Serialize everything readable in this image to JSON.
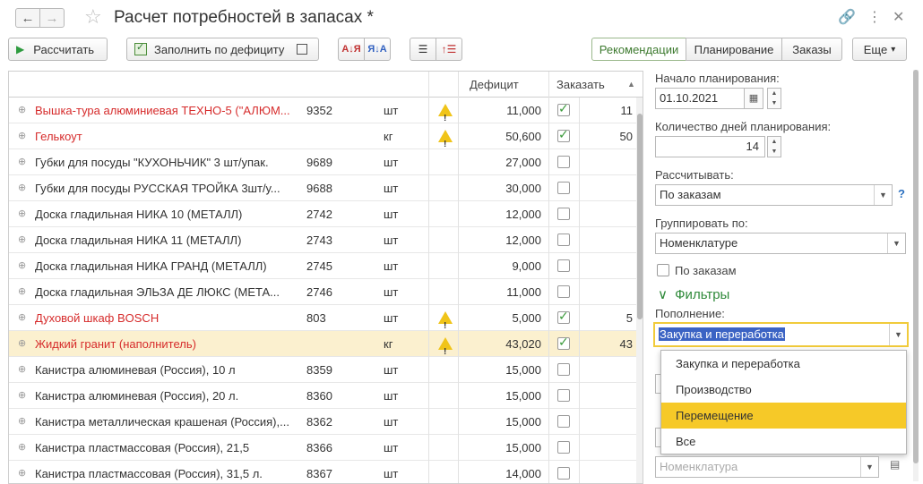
{
  "window": {
    "title": "Расчет потребностей в запасах *",
    "back_icon": "←",
    "forward_icon": "→",
    "star_icon": "☆",
    "link_icon": "🔗",
    "more_icon": "⋮",
    "close_icon": "✕"
  },
  "toolbar": {
    "calculate_label": "Рассчитать",
    "fill_label": "Заполнить по дефициту",
    "sort_asc_label": "А↓Я",
    "sort_desc_label": "Я↓А",
    "tabs": [
      {
        "label": "Рекомендации",
        "active": true
      },
      {
        "label": "Планирование",
        "active": false
      },
      {
        "label": "Заказы",
        "active": false
      }
    ],
    "more_label": "Еще",
    "more_arrow": "▾"
  },
  "table": {
    "columns": {
      "deficit": "Дефицит",
      "order": "Заказать"
    },
    "rows": [
      {
        "name": "Вышка-тура алюминиевая ТЕХНО-5 (\"АЛЮМ...",
        "code": "9352",
        "unit": "шт",
        "warn": true,
        "deficit": "11,000",
        "order": true,
        "cut": "11",
        "red": true,
        "selected": false
      },
      {
        "name": "Гелькоут",
        "code": "",
        "unit": "кг",
        "warn": true,
        "deficit": "50,600",
        "order": true,
        "cut": "50",
        "red": true,
        "selected": false
      },
      {
        "name": "Губки для посуды \"КУХОНЬЧИК\" 3 шт/упак.",
        "code": "9689",
        "unit": "шт",
        "warn": false,
        "deficit": "27,000",
        "order": false,
        "cut": "",
        "red": false,
        "selected": false
      },
      {
        "name": "Губки для посуды РУССКАЯ ТРОЙКА 3шт/у...",
        "code": "9688",
        "unit": "шт",
        "warn": false,
        "deficit": "30,000",
        "order": false,
        "cut": "",
        "red": false,
        "selected": false
      },
      {
        "name": "Доска гладильная  НИКА 10 (МЕТАЛЛ)",
        "code": "2742",
        "unit": "шт",
        "warn": false,
        "deficit": "12,000",
        "order": false,
        "cut": "",
        "red": false,
        "selected": false
      },
      {
        "name": "Доска гладильная  НИКА 11 (МЕТАЛЛ)",
        "code": "2743",
        "unit": "шт",
        "warn": false,
        "deficit": "12,000",
        "order": false,
        "cut": "",
        "red": false,
        "selected": false
      },
      {
        "name": "Доска гладильная  НИКА ГРАНД (МЕТАЛЛ)",
        "code": "2745",
        "unit": "шт",
        "warn": false,
        "deficit": "9,000",
        "order": false,
        "cut": "",
        "red": false,
        "selected": false
      },
      {
        "name": "Доска гладильная  ЭЛЬЗА ДЕ ЛЮКС (МЕТА...",
        "code": "2746",
        "unit": "шт",
        "warn": false,
        "deficit": "11,000",
        "order": false,
        "cut": "",
        "red": false,
        "selected": false
      },
      {
        "name": "Духовой шкаф                  BOSCH",
        "code": "803",
        "unit": "шт",
        "warn": true,
        "deficit": "5,000",
        "order": true,
        "cut": "5",
        "red": true,
        "selected": false
      },
      {
        "name": "Жидкий гранит (наполнитель)",
        "code": "",
        "unit": "кг",
        "warn": true,
        "deficit": "43,020",
        "order": true,
        "cut": "43",
        "red": true,
        "selected": true
      },
      {
        "name": "Канистра алюминевая (Россия), 10 л",
        "code": "8359",
        "unit": "шт",
        "warn": false,
        "deficit": "15,000",
        "order": false,
        "cut": "",
        "red": false,
        "selected": false
      },
      {
        "name": "Канистра алюминевая (Россия), 20 л.",
        "code": "8360",
        "unit": "шт",
        "warn": false,
        "deficit": "15,000",
        "order": false,
        "cut": "",
        "red": false,
        "selected": false
      },
      {
        "name": "Канистра металлическая крашеная (Россия),...",
        "code": "8362",
        "unit": "шт",
        "warn": false,
        "deficit": "15,000",
        "order": false,
        "cut": "",
        "red": false,
        "selected": false
      },
      {
        "name": "Канистра пластмассовая (Россия), 21,5",
        "code": "8366",
        "unit": "шт",
        "warn": false,
        "deficit": "15,000",
        "order": false,
        "cut": "",
        "red": false,
        "selected": false
      },
      {
        "name": "Канистра пластмассовая (Россия), 31,5 л.",
        "code": "8367",
        "unit": "шт",
        "warn": false,
        "deficit": "14,000",
        "order": false,
        "cut": "",
        "red": false,
        "selected": false
      }
    ]
  },
  "panel": {
    "start_label": "Начало планирования:",
    "start_value": "01.10.2021",
    "days_label": "Количество дней планирования:",
    "days_value": "14",
    "calc_label": "Рассчитывать:",
    "calc_value": "По заказам",
    "help_mark": "?",
    "group_label": "Группировать по:",
    "group_value": "Номенклатуре",
    "by_orders_label": "По заказам",
    "filters_label": "Фильтры",
    "filters_chevron": "∨",
    "replenish_label": "Пополнение:",
    "replenish_value": "Закупка и переработка",
    "options": [
      "Закупка и переработка",
      "Производство",
      "Перемещение",
      "Все"
    ],
    "hot_option": 2,
    "nomenclature_placeholder": "Номенклатура"
  }
}
